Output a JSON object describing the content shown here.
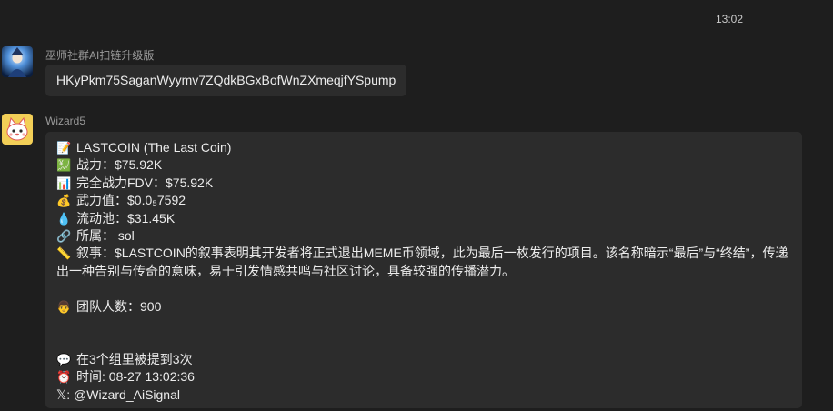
{
  "timestamp": "13:02",
  "messages": [
    {
      "sender": "巫师社群AI扫链升级版",
      "text": "HKyPkm75SaganWyymv7ZQdkBGxBofWnZXmeqjfYSpump"
    },
    {
      "sender": "Wizard5",
      "lines": {
        "token": {
          "icon": "📝",
          "text": "LASTCOIN (The Last Coin)"
        },
        "power": {
          "icon": "💹",
          "text": "战力：$75.92K"
        },
        "fdv": {
          "icon": "📊",
          "text": "完全战力FDV：$75.92K"
        },
        "weapon": {
          "icon": "💰",
          "text": "武力值：$0.0₅7592"
        },
        "pool": {
          "icon": "💧",
          "text": "流动池：$31.45K"
        },
        "chain": {
          "icon": "🔗",
          "text": "所属： sol"
        },
        "story": {
          "icon": "📏",
          "text": "叙事：$LASTCOIN的叙事表明其开发者将正式退出MEME币领域，此为最后一枚发行的项目。该名称暗示“最后”与“终结”，传递出一种告别与传奇的意味，易于引发情感共鸣与社区讨论，具备较强的传播潜力。"
        },
        "team": {
          "icon": "👨",
          "text": "团队人数：900"
        },
        "mentions": {
          "icon": "💬",
          "text": "在3个组里被提到3次"
        },
        "time": {
          "icon": "⏰",
          "text": "时间: 08-27 13:02:36"
        },
        "x": {
          "icon": "𝕏",
          "text": ": @Wizard_AiSignal"
        }
      }
    }
  ]
}
